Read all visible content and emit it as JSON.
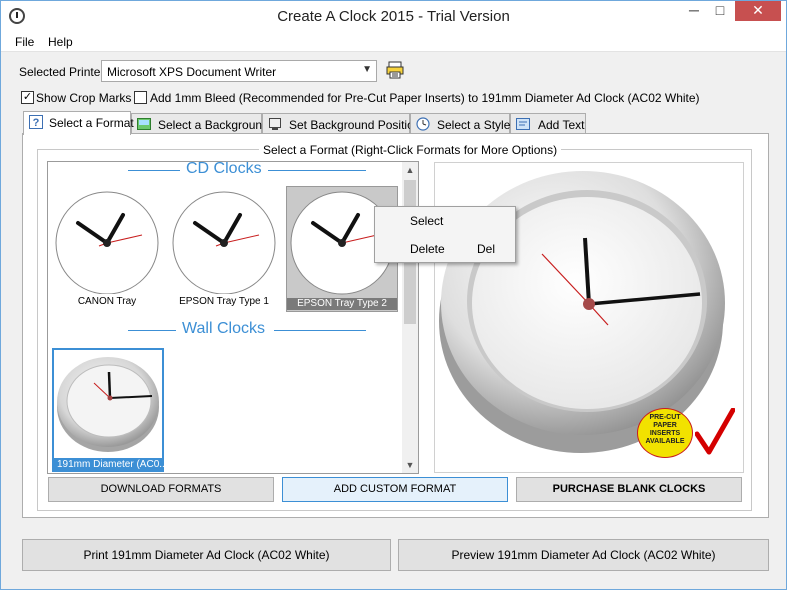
{
  "window": {
    "title": "Create A Clock 2015 - Trial Version",
    "minimize": "─",
    "maximize": "□",
    "close": "✕"
  },
  "menu": [
    "File",
    "Help"
  ],
  "printer": {
    "label": "Selected Printer",
    "value": "Microsoft XPS Document Writer",
    "icon": "printer-settings-icon"
  },
  "options": {
    "crop_marks": {
      "label": "Show Crop Marks",
      "checked": true
    },
    "bleed": {
      "label": "Add 1mm Bleed (Recommended for Pre-Cut Paper Inserts) to 191mm Diameter Ad Clock (AC02 White)",
      "checked": false
    }
  },
  "tabs": [
    {
      "label": "Select a Format",
      "icon": "help-icon",
      "active": true
    },
    {
      "label": "Select a Background",
      "icon": "background-icon"
    },
    {
      "label": "Set Background Position",
      "icon": "position-icon"
    },
    {
      "label": "Select a Style",
      "icon": "style-icon"
    },
    {
      "label": "Add Text",
      "icon": "text-icon"
    }
  ],
  "format_panel": {
    "title": "Select a Format (Right-Click Formats for More Options)",
    "sections": [
      {
        "title": "CD Clocks",
        "items": [
          {
            "caption": "CANON Tray"
          },
          {
            "caption": "EPSON Tray Type 1"
          },
          {
            "caption": "EPSON Tray Type 2",
            "selected": true
          }
        ]
      },
      {
        "title": "Wall Clocks",
        "items": [
          {
            "caption": "191mm Diameter (AC0...",
            "selected": true
          }
        ]
      }
    ]
  },
  "context_menu": {
    "items": [
      {
        "label": "Select",
        "shortcut": ""
      },
      {
        "label": "Delete",
        "shortcut": "Del"
      }
    ]
  },
  "preview": {
    "badge_lines": [
      "PRE-CUT",
      "PAPER",
      "INSERTS",
      "AVAILABLE"
    ],
    "badge_color": "#f2e200",
    "check_color": "#d40000"
  },
  "buttons": {
    "download": "DOWNLOAD FORMATS",
    "add_custom": "ADD CUSTOM FORMAT",
    "purchase": "PURCHASE BLANK CLOCKS",
    "print": "Print 191mm Diameter Ad Clock (AC02 White)",
    "preview": "Preview 191mm Diameter Ad Clock (AC02 White)"
  },
  "colors": {
    "accent": "#3c8fd5",
    "close_button": "#c75050",
    "second_hand": "#c81e1e"
  }
}
